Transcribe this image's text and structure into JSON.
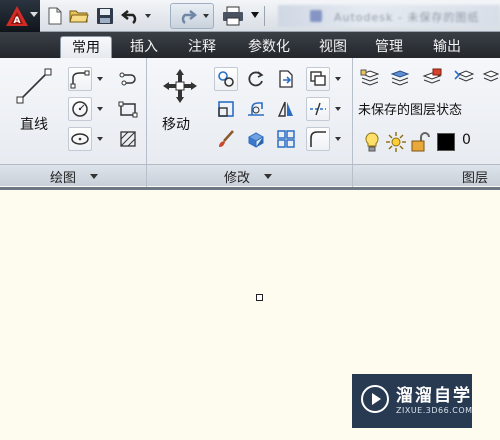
{
  "window": {
    "title_blurred": "Autodesk - 未保存的图纸"
  },
  "tabs": [
    "常用",
    "插入",
    "注释",
    "参数化",
    "视图",
    "管理",
    "输出"
  ],
  "active_tab": "常用",
  "panels": {
    "draw": {
      "footer": "绘图",
      "line_label": "直线"
    },
    "modify": {
      "footer": "修改",
      "move_label": "移动"
    },
    "layers": {
      "footer": "图层",
      "state_label": "未保存的图层状态",
      "current_layer": "0"
    }
  },
  "watermark": {
    "name": "溜溜自学",
    "url": "ZIXUE.3D66.COM"
  },
  "colors": {
    "accent_red": "#c8231f",
    "ribbon_dark": "#2b2f35",
    "canvas": "#fefbef"
  }
}
